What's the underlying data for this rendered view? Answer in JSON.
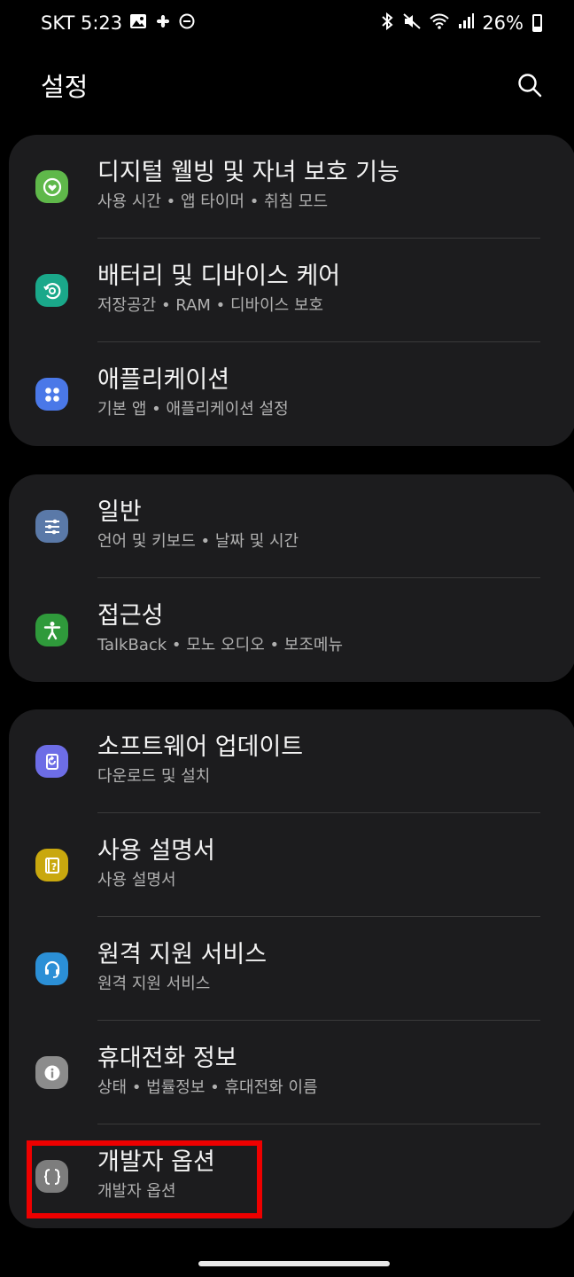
{
  "status_bar": {
    "carrier_time": "SKT 5:23",
    "battery_text": "26%",
    "battery_level": 0.26
  },
  "header": {
    "title": "설정"
  },
  "groups": [
    {
      "items": [
        {
          "title": "디지털 웰빙 및 자녀 보호 기능",
          "subtitle": "사용 시간 • 앱 타이머 • 취침 모드",
          "icon": "digital-wellbeing-icon",
          "color": "#5fb84a"
        },
        {
          "title": "배터리 및 디바이스 케어",
          "subtitle": "저장공간 • RAM • 디바이스 보호",
          "icon": "device-care-icon",
          "color": "#1aa88a"
        },
        {
          "title": "애플리케이션",
          "subtitle": "기본 앱 • 애플리케이션 설정",
          "icon": "apps-icon",
          "color": "#4a78e8"
        }
      ]
    },
    {
      "items": [
        {
          "title": "일반",
          "subtitle": "언어 및 키보드 • 날짜 및 시간",
          "icon": "general-management-icon",
          "color": "#5a79a8"
        },
        {
          "title": "접근성",
          "subtitle": "TalkBack • 모노 오디오 • 보조메뉴",
          "icon": "accessibility-icon",
          "color": "#2f9a3b"
        }
      ]
    },
    {
      "items": [
        {
          "title": "소프트웨어 업데이트",
          "subtitle": "다운로드 및 설치",
          "icon": "software-update-icon",
          "color": "#6d6de6"
        },
        {
          "title": "사용 설명서",
          "subtitle": "사용 설명서",
          "icon": "user-manual-icon",
          "color": "#c9a80e"
        },
        {
          "title": "원격 지원 서비스",
          "subtitle": "원격 지원 서비스",
          "icon": "remote-support-icon",
          "color": "#2b8fd6"
        },
        {
          "title": "휴대전화 정보",
          "subtitle": "상태 • 법률정보 • 휴대전화 이름",
          "icon": "phone-info-icon",
          "color": "#8c8c8c"
        },
        {
          "title": "개발자 옵션",
          "subtitle": "개발자 옵션",
          "icon": "developer-options-icon",
          "color": "#7d7d7d"
        }
      ]
    }
  ],
  "colors": {
    "background": "#000000",
    "card": "#1c1c1e",
    "highlight": "#e00000"
  }
}
